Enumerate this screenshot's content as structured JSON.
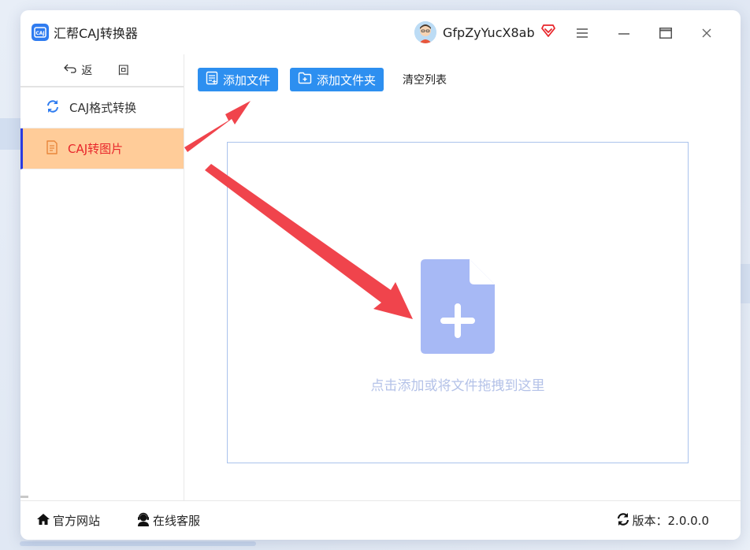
{
  "app": {
    "title": "汇帮CAJ转换器",
    "logo_text": "CAJ"
  },
  "user": {
    "name": "GfpZyYucX8ab"
  },
  "window_controls": [
    "menu-icon",
    "minimize-icon",
    "maximize-icon",
    "close-icon"
  ],
  "sidebar": {
    "back_label": "返 回",
    "items": [
      {
        "label": "CAJ格式转换",
        "icon": "refresh-icon",
        "active": false
      },
      {
        "label": "CAJ转图片",
        "icon": "document-icon",
        "active": true
      }
    ]
  },
  "toolbar": {
    "add_file": "添加文件",
    "add_folder": "添加文件夹",
    "clear_list": "清空列表"
  },
  "dropzone": {
    "hint": "点击添加或将文件拖拽到这里"
  },
  "footer": {
    "website": "官方网站",
    "support": "在线客服",
    "version": "版本：2.0.0.0"
  },
  "colors": {
    "accent": "#2d8ff0",
    "active_bg": "#ffcc99",
    "active_text": "#e8262b",
    "arrow": "#f0444c",
    "file_icon": "#a7b9f5"
  }
}
